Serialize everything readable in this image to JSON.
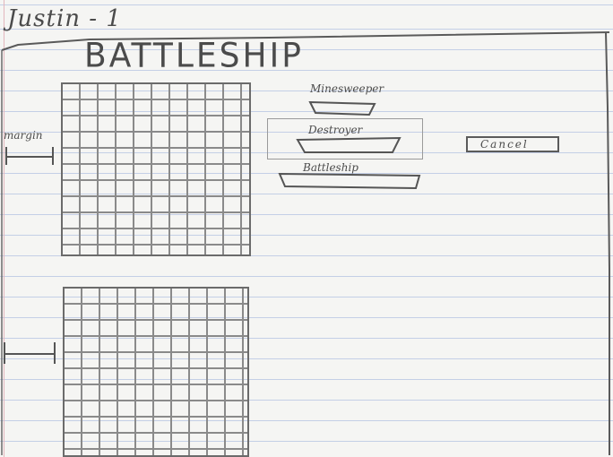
{
  "sketch": {
    "author_note": "Justin - 1",
    "title": "BATTLESHIP",
    "margin_label": "margin"
  },
  "ships": [
    {
      "name": "Minesweeper"
    },
    {
      "name": "Destroyer"
    },
    {
      "name": "Battleship"
    }
  ],
  "buttons": {
    "cancel_label": "Cancel"
  },
  "colors": {
    "paper": "#f5f5f3",
    "rule_line": "#c4cfe6",
    "pencil": "#4b4b4b"
  }
}
